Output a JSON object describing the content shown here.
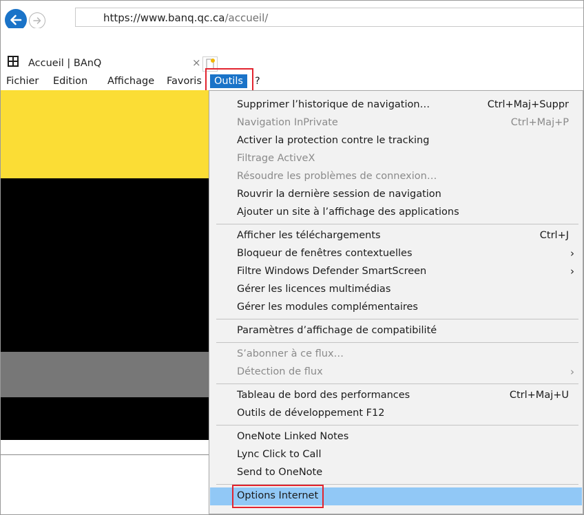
{
  "browser": {
    "url_domain": "https://www.banq.qc.ca",
    "url_path": "/accueil/",
    "tab_title": "Accueil | BAnQ",
    "tab_close_glyph": "×",
    "favicon_glyph": "BAnQ",
    "accent": "#1a73c8"
  },
  "menubar": {
    "items": [
      "Fichier",
      "Edition",
      "Affichage",
      "Favoris",
      "Outils",
      "?"
    ],
    "active": "Outils"
  },
  "tools_menu": {
    "items": [
      {
        "label": "Supprimer l’historique de navigation…",
        "shortcut": "Ctrl+Maj+Suppr",
        "enabled": true
      },
      {
        "label": "Navigation InPrivate",
        "shortcut": "Ctrl+Maj+P",
        "enabled": false
      },
      {
        "label": "Activer la protection contre le tracking",
        "shortcut": "",
        "enabled": true
      },
      {
        "label": "Filtrage ActiveX",
        "shortcut": "",
        "enabled": false
      },
      {
        "label": "Résoudre les problèmes de connexion…",
        "shortcut": "",
        "enabled": false
      },
      {
        "label": "Rouvrir la dernière session de navigation",
        "shortcut": "",
        "enabled": true
      },
      {
        "label": "Ajouter un site à l’affichage des applications",
        "shortcut": "",
        "enabled": true
      },
      {
        "label": "Afficher les téléchargements",
        "shortcut": "Ctrl+J",
        "enabled": true
      },
      {
        "label": "Bloqueur de fenêtres contextuelles",
        "shortcut": "",
        "submenu": true,
        "enabled": true
      },
      {
        "label": "Filtre Windows Defender SmartScreen",
        "shortcut": "",
        "submenu": true,
        "enabled": true
      },
      {
        "label": "Gérer les licences multimédias",
        "shortcut": "",
        "enabled": true
      },
      {
        "label": "Gérer les modules complémentaires",
        "shortcut": "",
        "enabled": true
      },
      {
        "label": "Paramètres d’affichage de compatibilité",
        "shortcut": "",
        "enabled": true
      },
      {
        "label": "S’abonner à ce flux…",
        "shortcut": "",
        "enabled": false
      },
      {
        "label": "Détection de flux",
        "shortcut": "",
        "submenu": true,
        "enabled": false
      },
      {
        "label": "Tableau de bord des performances",
        "shortcut": "Ctrl+Maj+U",
        "enabled": true
      },
      {
        "label": "Outils de développement F12",
        "shortcut": "",
        "enabled": true
      },
      {
        "label": "OneNote Linked Notes",
        "shortcut": "",
        "enabled": true
      },
      {
        "label": "Lync Click to Call",
        "shortcut": "",
        "enabled": true
      },
      {
        "label": "Send to OneNote",
        "shortcut": "",
        "enabled": true
      },
      {
        "label": "Options Internet",
        "shortcut": "",
        "enabled": true,
        "highlighted": true
      }
    ],
    "submenu_glyph": "›"
  },
  "highlight_color": "#e2232e",
  "page_colors": {
    "yellow": "#fbdd35",
    "black": "#000000",
    "gray": "#777777"
  }
}
